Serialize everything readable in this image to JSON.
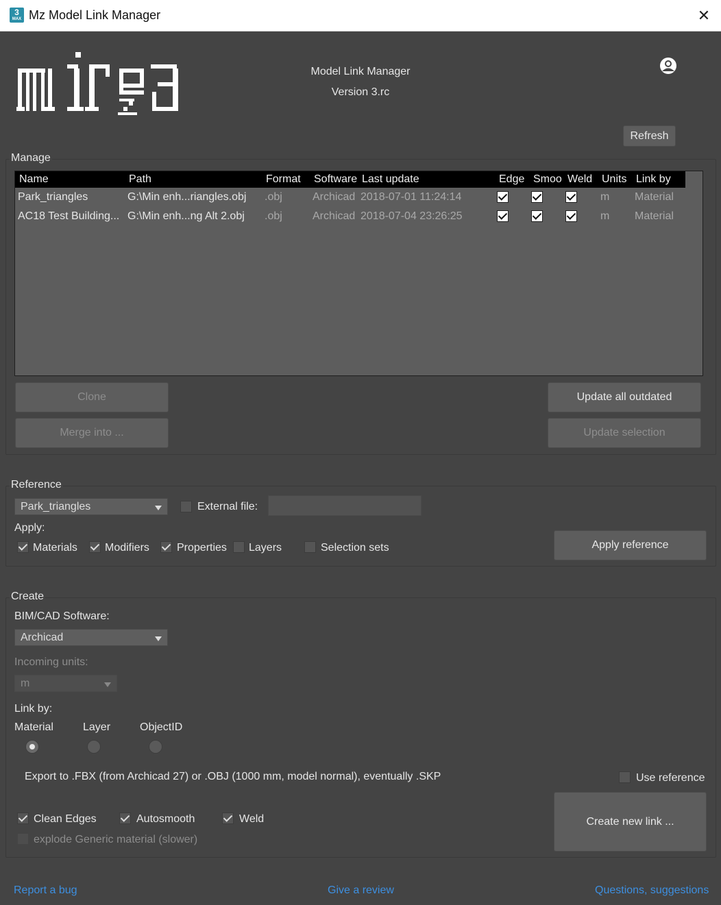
{
  "window": {
    "title": "Mz Model Link Manager",
    "icon_label": "3",
    "icon_sub": "MAX"
  },
  "header": {
    "logo_text": "mizei",
    "app_name": "Model Link Manager",
    "version": "Version 3.rc",
    "refresh_label": "Refresh"
  },
  "manage": {
    "label": "Manage",
    "columns": [
      "Name",
      "Path",
      "Format",
      "Software",
      "Last update",
      "Edge",
      "Smoo",
      "Weld",
      "Units",
      "Link by"
    ],
    "rows": [
      {
        "name": "Park_triangles",
        "path": "G:\\Min enh...riangles.obj",
        "format": ".obj",
        "software": "Archicad",
        "last_update": "2018-07-01 11:24:14",
        "edge": true,
        "smooth": true,
        "weld": true,
        "units": "m",
        "link_by": "Material"
      },
      {
        "name": "AC18 Test Building...",
        "path": "G:\\Min enh...ng Alt 2.obj",
        "format": ".obj",
        "software": "Archicad",
        "last_update": "2018-07-04 23:26:25",
        "edge": true,
        "smooth": true,
        "weld": true,
        "units": "m",
        "link_by": "Material"
      }
    ],
    "clone_label": "Clone",
    "merge_label": "Merge into ...",
    "update_all_label": "Update all outdated",
    "update_selection_label": "Update selection"
  },
  "reference": {
    "label": "Reference",
    "selected": "Park_triangles",
    "external_file_label": "External file:",
    "external_file_value": "",
    "apply_label": "Apply:",
    "options": [
      {
        "label": "Materials",
        "checked": true
      },
      {
        "label": "Modifiers",
        "checked": true
      },
      {
        "label": "Properties",
        "checked": true
      },
      {
        "label": "Layers",
        "checked": false
      },
      {
        "label": "Selection sets",
        "checked": false
      }
    ],
    "apply_reference_label": "Apply reference"
  },
  "create": {
    "label": "Create",
    "software_label": "BIM/CAD Software:",
    "software_value": "Archicad",
    "units_label": "Incoming units:",
    "units_value": "m",
    "link_by_label": "Link by:",
    "link_by_options": [
      "Material",
      "Layer",
      "ObjectID"
    ],
    "link_by_selected": "Material",
    "export_hint": "Export to .FBX (from Archicad 27) or .OBJ (1000 mm, model normal), eventually .SKP",
    "use_reference_label": "Use reference",
    "clean_edges_label": "Clean Edges",
    "autosmooth_label": "Autosmooth",
    "weld_label": "Weld",
    "explode_label": "explode Generic material (slower)",
    "create_label": "Create new link ..."
  },
  "footer": {
    "bug_label": "Report a bug",
    "review_label": "Give a review",
    "questions_label": "Questions, suggestions"
  }
}
